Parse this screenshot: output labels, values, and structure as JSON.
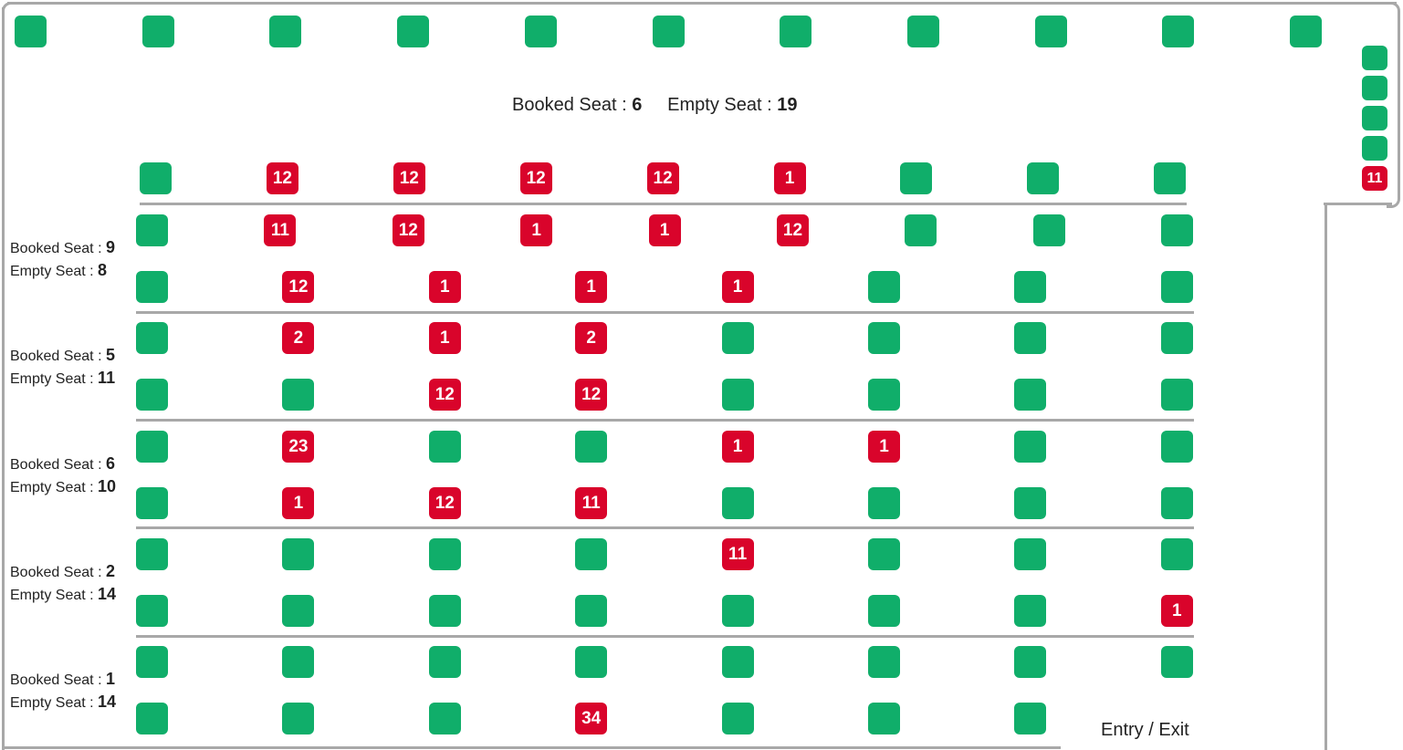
{
  "colors": {
    "empty": "#10ae6a",
    "booked": "#d9042b"
  },
  "summary": {
    "booked_label": "Booked Seat :",
    "booked": "6",
    "empty_label": "Empty Seat :",
    "empty": "19"
  },
  "entry_exit": "Entry / Exit",
  "top_row": [
    null,
    null,
    null,
    null,
    null,
    null,
    null,
    null,
    null,
    null,
    null
  ],
  "right_column": [
    null,
    null,
    null,
    null,
    "11"
  ],
  "front_row": [
    null,
    "12",
    "12",
    "12",
    "12",
    "1",
    null,
    null,
    null
  ],
  "sections": [
    {
      "booked_label": "Booked Seat :",
      "booked": "9",
      "empty_label": "Empty Seat :",
      "empty": "8",
      "rows": [
        [
          null,
          "11",
          "12",
          "1",
          "1",
          "12",
          null,
          null,
          null
        ],
        [
          null,
          "12",
          "1",
          "1",
          "1",
          null,
          null,
          null
        ]
      ]
    },
    {
      "booked_label": "Booked Seat :",
      "booked": "5",
      "empty_label": "Empty Seat :",
      "empty": "11",
      "rows": [
        [
          null,
          "2",
          "1",
          "2",
          null,
          null,
          null,
          null
        ],
        [
          null,
          null,
          "12",
          "12",
          null,
          null,
          null,
          null
        ]
      ]
    },
    {
      "booked_label": "Booked Seat :",
      "booked": "6",
      "empty_label": "Empty Seat :",
      "empty": "10",
      "rows": [
        [
          null,
          "23",
          null,
          null,
          "1",
          "1",
          null,
          null
        ],
        [
          null,
          "1",
          "12",
          "11",
          null,
          null,
          null,
          null
        ]
      ]
    },
    {
      "booked_label": "Booked Seat :",
      "booked": "2",
      "empty_label": "Empty Seat :",
      "empty": "14",
      "rows": [
        [
          null,
          null,
          null,
          null,
          "11",
          null,
          null,
          null
        ],
        [
          null,
          null,
          null,
          null,
          null,
          null,
          null,
          "1"
        ]
      ]
    },
    {
      "booked_label": "Booked Seat :",
      "booked": "1",
      "empty_label": "Empty Seat :",
      "empty": "14",
      "rows": [
        [
          null,
          null,
          null,
          null,
          null,
          null,
          null,
          null
        ],
        [
          null,
          null,
          null,
          "34",
          null,
          null,
          null
        ]
      ]
    }
  ]
}
